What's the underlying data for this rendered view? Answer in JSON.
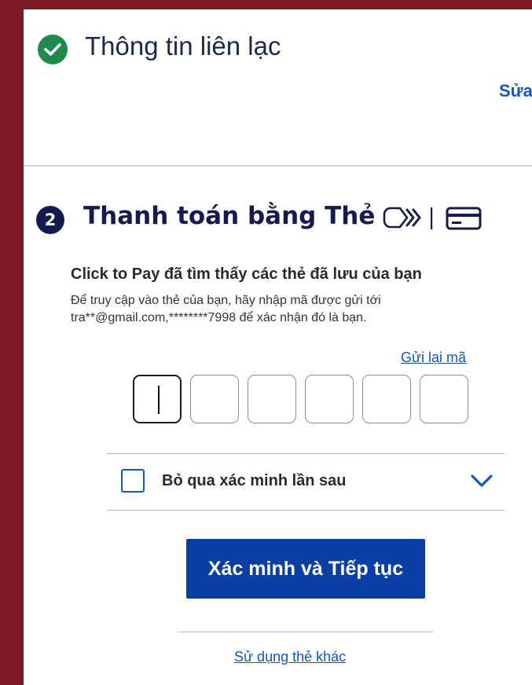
{
  "contact_section": {
    "title": "Thông tin liên lạc",
    "edit_label": "Sửa",
    "status_icon": "check-circle-icon",
    "status_color": "#1e8a4e"
  },
  "payment_section": {
    "step_number": "2",
    "title": "Thanh toán bằng Thẻ",
    "icons": [
      "click-to-pay-icon",
      "credit-card-icon"
    ],
    "found_title": "Click to Pay đã tìm thấy các thẻ đã lưu của bạn",
    "found_desc": "Để truy cập vào thẻ của bạn, hãy nhập mã được gửi tới tra**@gmail.com,********7998 để xác nhận đó là bạn.",
    "resend_label": "Gửi lại mã",
    "otp_values": [
      "",
      "",
      "",
      "",
      "",
      ""
    ],
    "skip_label": "Bỏ qua xác minh lần sau",
    "skip_checked": false,
    "verify_button": "Xác minh và Tiếp tục",
    "other_card_link": "Sử dụng thẻ khác"
  },
  "colors": {
    "accent": "#1357c2",
    "button": "#0a3fa6",
    "heading": "#161b4f",
    "background": "#7d1a28"
  }
}
